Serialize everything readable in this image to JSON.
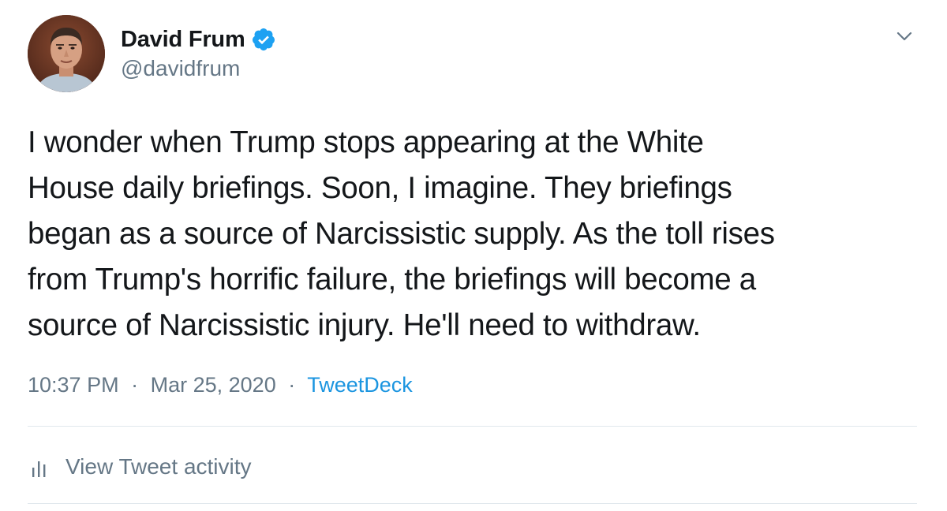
{
  "author": {
    "display_name": "David Frum",
    "handle": "@davidfrum",
    "verified": true
  },
  "tweet": {
    "lines": [
      "I wonder when Trump stops appearing at the White",
      "House daily briefings. Soon, I imagine. They briefings",
      "began as a source of Narcissistic supply. As the toll rises",
      "from Trump's horrific failure, the briefings will become a",
      "source of Narcissistic injury. He'll need to withdraw."
    ],
    "time": "10:37 PM",
    "separator": "·",
    "date": "Mar 25, 2020",
    "source": "TweetDeck"
  },
  "actions": {
    "view_activity_label": "View Tweet activity"
  },
  "icons": {
    "verified": "verified-badge-icon",
    "more": "chevron-down-icon",
    "activity": "bar-chart-icon"
  },
  "colors": {
    "text": "#14171a",
    "secondary": "#657786",
    "link": "#1b95e0",
    "verified": "#1da1f2",
    "divider": "#e1e8ed"
  }
}
